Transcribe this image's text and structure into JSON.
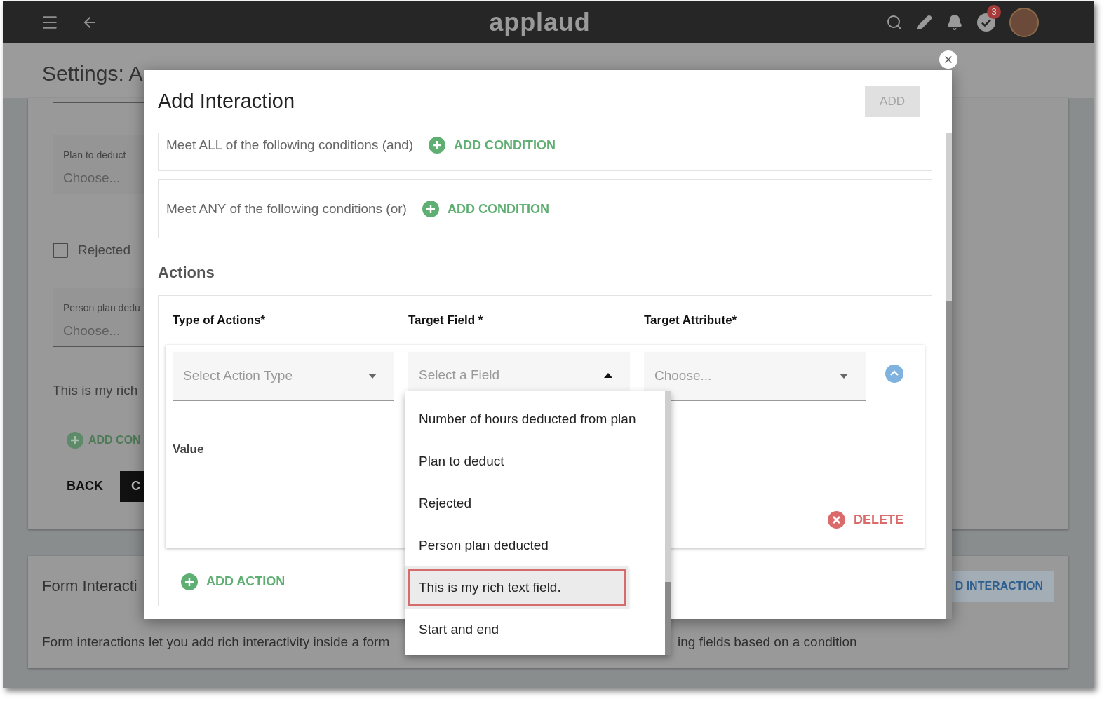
{
  "app_bar": {
    "logo": "applaud",
    "notification_count": "3"
  },
  "page": {
    "title": "Settings: A",
    "fields": [
      {
        "kind": "select",
        "label": "Plan to deduct",
        "placeholder": "Choose..."
      },
      {
        "kind": "checkbox",
        "label": "Rejected",
        "checked": false
      },
      {
        "kind": "select",
        "label": "Person plan dedu",
        "placeholder": "Choose..."
      },
      {
        "kind": "text",
        "text": "This is my rich"
      }
    ],
    "add_condition": "ADD CON",
    "back": "BACK",
    "continue": "C",
    "form_interactions": {
      "title": "Form Interacti",
      "button": "D INTERACTION",
      "description_left": "Form interactions let you add rich interactivity inside a form",
      "description_right": "ing fields based on a condition"
    }
  },
  "dialog": {
    "title": "Add Interaction",
    "add_button": "ADD",
    "add_disabled": true,
    "condition_groups": [
      {
        "label": "Meet ALL of the following conditions (and)",
        "button": "ADD CONDITION"
      },
      {
        "label": "Meet ANY of the following conditions (or)",
        "button": "ADD CONDITION"
      }
    ],
    "actions": {
      "heading": "Actions",
      "columns": [
        "Type of Actions*",
        "Target Field *",
        "Target Attribute*"
      ],
      "selects": [
        {
          "placeholder": "Select Action Type",
          "open": false
        },
        {
          "placeholder": "Select a Field",
          "open": true
        },
        {
          "placeholder": "Choose...",
          "open": false
        }
      ],
      "value_label": "Value",
      "delete": "DELETE",
      "add_action": "ADD ACTION"
    }
  },
  "dropdown": {
    "items": [
      {
        "label": "Number of hours deducted from plan",
        "selected": false,
        "outlined": false
      },
      {
        "label": "Plan to deduct",
        "selected": false,
        "outlined": false
      },
      {
        "label": "Rejected",
        "selected": false,
        "outlined": false
      },
      {
        "label": "Person plan deducted",
        "selected": false,
        "outlined": false
      },
      {
        "label": "This is my rich text field.",
        "selected": true,
        "outlined": true
      },
      {
        "label": "Start and end",
        "selected": false,
        "outlined": false
      }
    ]
  }
}
